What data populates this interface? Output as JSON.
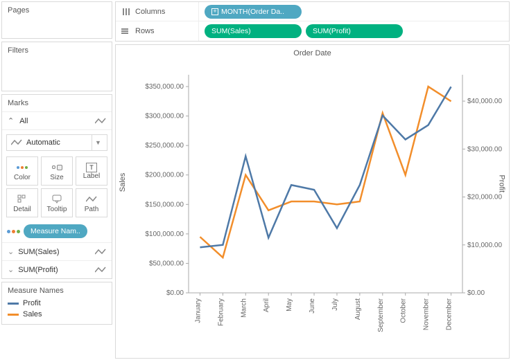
{
  "panels": {
    "pages": "Pages",
    "filters": "Filters",
    "marks": "Marks",
    "all": "All",
    "mark_type": "Automatic",
    "buttons": {
      "color": "Color",
      "size": "Size",
      "label": "Label",
      "detail": "Detail",
      "tooltip": "Tooltip",
      "path": "Path"
    },
    "color_pill": "Measure Nam..",
    "sub_items": [
      "SUM(Sales)",
      "SUM(Profit)"
    ]
  },
  "legend": {
    "title": "Measure Names",
    "items": [
      {
        "label": "Profit",
        "color": "#4e79a7"
      },
      {
        "label": "Sales",
        "color": "#f28e2b"
      }
    ]
  },
  "shelves": {
    "columns_label": "Columns",
    "rows_label": "Rows",
    "columns_pill": "MONTH(Order Da..",
    "rows_pills": [
      "SUM(Sales)",
      "SUM(Profit)"
    ]
  },
  "chart_title": "Order Date",
  "y_left_label": "Sales",
  "y_right_label": "Profit",
  "chart_data": {
    "type": "line",
    "title": "Order Date",
    "x_categories": [
      "January",
      "February",
      "March",
      "April",
      "May",
      "June",
      "July",
      "August",
      "September",
      "October",
      "November",
      "December"
    ],
    "series": [
      {
        "name": "Sales",
        "axis": "left",
        "color": "#f28e2b",
        "values": [
          95000,
          60000,
          200000,
          140000,
          155000,
          155000,
          150000,
          155000,
          305000,
          200000,
          350000,
          325000
        ]
      },
      {
        "name": "Profit",
        "axis": "right",
        "color": "#4e79a7",
        "values": [
          9500,
          10000,
          28500,
          11500,
          22500,
          21500,
          13500,
          22500,
          37000,
          32000,
          35000,
          43000
        ]
      }
    ],
    "y_left": {
      "label": "Sales",
      "range": [
        0,
        370000
      ],
      "ticks": [
        0,
        50000,
        100000,
        150000,
        200000,
        250000,
        300000,
        350000
      ],
      "tick_labels": [
        "$0.00",
        "$50,000.00",
        "$100,000.00",
        "$150,000.00",
        "$200,000.00",
        "$250,000.00",
        "$300,000.00",
        "$350,000.00"
      ]
    },
    "y_right": {
      "label": "Profit",
      "range": [
        0,
        45500
      ],
      "ticks": [
        0,
        10000,
        20000,
        30000,
        40000
      ],
      "tick_labels": [
        "$0.00",
        "$10,000.00",
        "$20,000.00",
        "$30,000.00",
        "$40,000.00"
      ]
    }
  }
}
